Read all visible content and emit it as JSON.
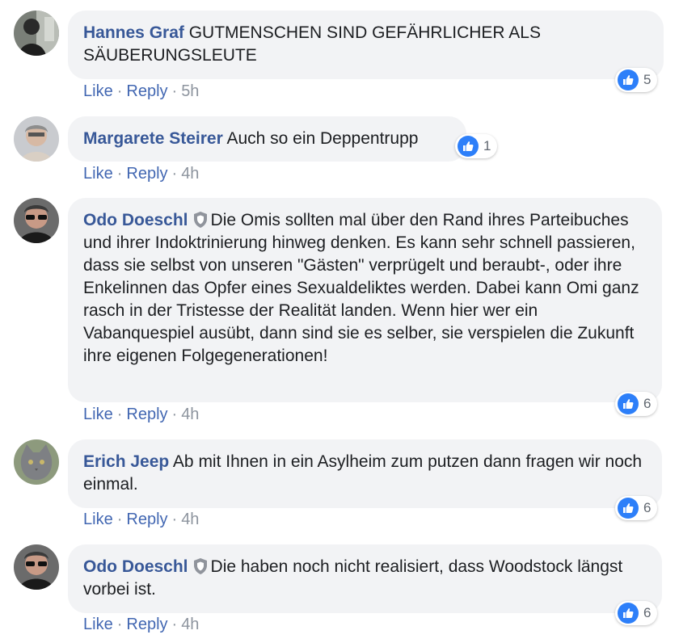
{
  "comments": [
    {
      "author": "Hannes Graf",
      "verified": false,
      "text": "GUTMENSCHEN SIND GEFÄHRLICHER ALS SÄUBERUNGSLEUTE",
      "like_label": "Like",
      "reply_label": "Reply",
      "separator": "·",
      "time": "5h",
      "reactions": "5",
      "avatar_icon": "person-avatar-icon"
    },
    {
      "author": "Margarete Steirer",
      "verified": false,
      "text": "Auch so ein Deppentrupp",
      "like_label": "Like",
      "reply_label": "Reply",
      "separator": "·",
      "time": "4h",
      "reactions": "1",
      "avatar_icon": "person-avatar-icon"
    },
    {
      "author": "Odo Doeschl",
      "verified": true,
      "text": "Die Omis sollten mal über den Rand ihres Parteibuches und ihrer Indoktrinierung hinweg denken. Es kann sehr schnell passieren, dass sie selbst von unseren \"Gästen\" verprügelt und beraubt-, oder ihre Enkelinnen das Opfer eines Sexualdeliktes werden. Dabei kann Omi ganz rasch in der Tristesse der Realität landen. Wenn hier wer ein Vabanquespiel ausübt, dann sind sie es selber, sie verspielen die Zukunft ihre eigenen Folgegenerationen!",
      "like_label": "Like",
      "reply_label": "Reply",
      "separator": "·",
      "time": "4h",
      "reactions": "6",
      "avatar_icon": "person-avatar-icon"
    },
    {
      "author": "Erich Jeep",
      "verified": false,
      "text": "Ab mit Ihnen in ein Asylheim zum putzen dann fragen wir noch einmal.",
      "like_label": "Like",
      "reply_label": "Reply",
      "separator": "·",
      "time": "4h",
      "reactions": "6",
      "avatar_icon": "cat-avatar-icon"
    },
    {
      "author": "Odo Doeschl",
      "verified": true,
      "text": "Die haben noch nicht realisiert, dass Woodstock längst vorbei ist.",
      "like_label": "Like",
      "reply_label": "Reply",
      "separator": "·",
      "time": "4h",
      "reactions": "6",
      "avatar_icon": "person-avatar-icon"
    }
  ],
  "colors": {
    "author": "#385898",
    "link": "#4267b2",
    "bubble": "#f2f3f5",
    "like_badge": "#2d7ff9",
    "meta": "#8d949e"
  }
}
